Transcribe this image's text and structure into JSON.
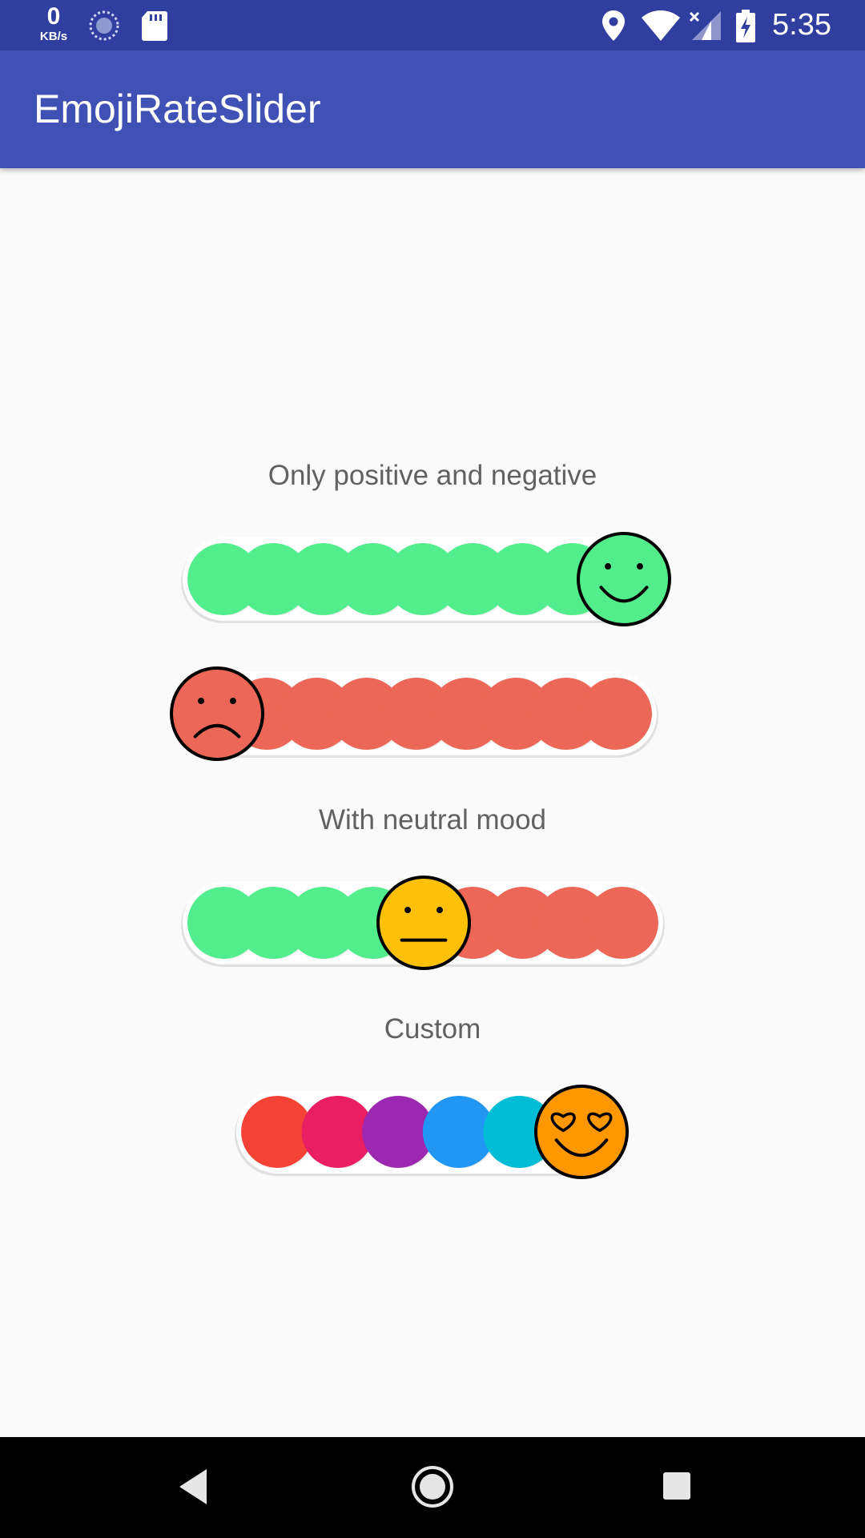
{
  "status_bar": {
    "network_speed_value": "0",
    "network_speed_unit": "KB/s",
    "time": "5:35",
    "icons": [
      "sync-icon",
      "sd-card-icon",
      "location-icon",
      "wifi-icon",
      "cellular-no-signal-icon",
      "battery-charging-icon"
    ]
  },
  "app_bar": {
    "title": "EmojiRateSlider"
  },
  "sections": {
    "only_pos_neg": "Only positive and negative",
    "with_neutral": "With neutral mood",
    "custom": "Custom"
  },
  "sliders": [
    {
      "name": "positive-slider",
      "level": 1.0,
      "emoji": "smiling-face-icon",
      "colors": [
        "#52ed8c",
        "#52ed8c",
        "#52ed8c",
        "#52ed8c",
        "#52ed8c",
        "#52ed8c",
        "#52ed8c",
        "#52ed8c",
        "#52ed8c"
      ],
      "thumb_color": "#52ed8c"
    },
    {
      "name": "negative-slider",
      "level": 0.0,
      "emoji": "frowning-face-icon",
      "colors": [
        "#ec6757",
        "#ec6757",
        "#ec6757",
        "#ec6757",
        "#ec6757",
        "#ec6757",
        "#ec6757",
        "#ec6757",
        "#ec6757"
      ],
      "thumb_color": "#ec6757"
    },
    {
      "name": "neutral-slider",
      "level": 0.5,
      "emoji": "neutral-face-icon",
      "colors": [
        "#52ed8c",
        "#52ed8c",
        "#52ed8c",
        "#52ed8c",
        "#52ed8c",
        "#ec6757",
        "#ec6757",
        "#ec6757",
        "#ec6757"
      ],
      "thumb_color": "#ffc107"
    },
    {
      "name": "custom-slider",
      "level": 1.0,
      "emoji": "heart-eyes-face-icon",
      "colors": [
        "#f44336",
        "#e91e63",
        "#9c27b0",
        "#2196f3",
        "#00bcd4",
        "#4caf50"
      ],
      "thumb_color": "#ff9800"
    }
  ],
  "nav_bar": {
    "buttons": [
      "back-icon",
      "home-icon",
      "recents-icon"
    ]
  },
  "colors": {
    "status_bar": "#303f9f",
    "app_bar": "#3f51b5",
    "background": "#fafafa",
    "positive": "#52ed8c",
    "negative": "#ec6757",
    "neutral": "#ffc107"
  }
}
